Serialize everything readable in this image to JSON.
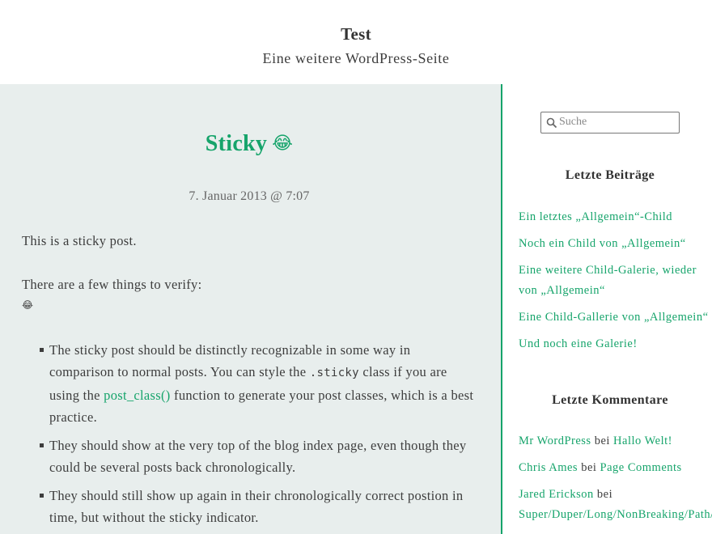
{
  "header": {
    "site_title": "Test",
    "site_description": "Eine weitere WordPress-Seite"
  },
  "post": {
    "title": "Sticky",
    "title_emoji": "😂",
    "date": "7. Januar 2013 @ 7:07",
    "paragraph_1": "This is a sticky post.",
    "paragraph_2": "There are a few things to verify:",
    "inline_emoji": "😂",
    "list": [
      {
        "before": "The sticky post should be distinctly recognizable in some way in comparison to normal posts. You can style the ",
        "code": ".sticky",
        "middle": " class if you are using the ",
        "link": "post_class()",
        "after": " function to generate your post classes, which is a best practice."
      },
      {
        "text": "They should show at the very top of the blog index page, even though they could be several posts back chronologically."
      },
      {
        "text": "They should still show up again in their chronologically correct postion in time, but without the sticky indicator."
      }
    ]
  },
  "sidebar": {
    "search_placeholder": "Suche",
    "recent_posts_title": "Letzte Beiträge",
    "recent_posts": [
      "Ein letztes „Allgemein“-Child",
      "Noch ein Child von „Allgemein“",
      "Eine weitere Child-Galerie, wieder von „Allgemein“",
      "Eine Child-Gallerie von „Allgemein“",
      "Und noch eine Galerie!"
    ],
    "recent_comments_title": "Letzte Kommentare",
    "recent_comments": [
      {
        "author": "Mr WordPress",
        "by": " bei ",
        "post": "Hallo Welt!"
      },
      {
        "author": "Chris Ames",
        "by": " bei ",
        "post": "Page Comments"
      },
      {
        "author": "Jared Erickson",
        "by": " bei ",
        "post": "Super/Duper/Long/NonBreaking/Path/Name/To/A/File/That/Is"
      }
    ]
  },
  "colors": {
    "accent": "#16a46b",
    "content_background": "#e8eeed",
    "text": "#3d3d3d"
  },
  "icons": {
    "search": "search-icon"
  }
}
